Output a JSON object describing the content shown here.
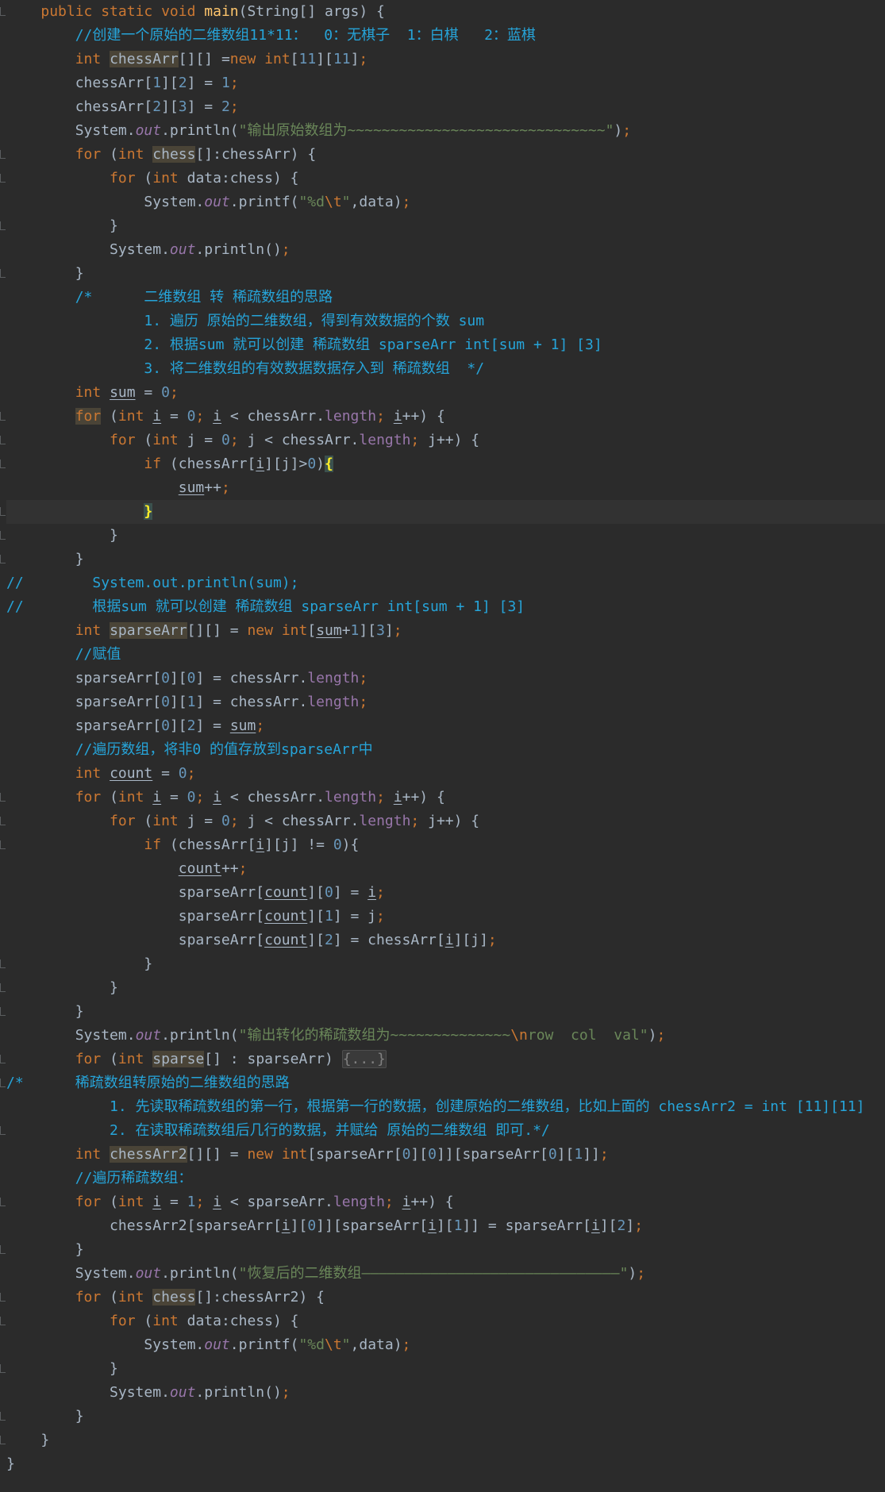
{
  "colors": {
    "background": "#2b2b2b",
    "keyword": "#cc7832",
    "number": "#6897bb",
    "string": "#6a8759",
    "comment": "#26a4d9",
    "field": "#9876aa",
    "method": "#ffc66d",
    "plain": "#a9b7c6"
  },
  "code_lines": [
    [
      [
        "    ",
        ""
      ],
      [
        "public static void ",
        "kw"
      ],
      [
        "main",
        "fn"
      ],
      [
        "(String[] args) {",
        ""
      ]
    ],
    [
      [
        "        ",
        ""
      ],
      [
        "//创建一个原始的二维数组11*11：  0：无棋子  1：白棋   2：蓝棋",
        "cmt"
      ]
    ],
    [
      [
        "        ",
        ""
      ],
      [
        "int ",
        "kw"
      ],
      [
        "chessArr",
        "hl"
      ],
      [
        "[][] =",
        ""
      ],
      [
        "new ",
        "kw"
      ],
      [
        "int",
        "kw"
      ],
      [
        "[",
        ""
      ],
      [
        "11",
        "num"
      ],
      [
        "][",
        ""
      ],
      [
        "11",
        "num"
      ],
      [
        "]",
        ""
      ],
      [
        ";",
        "kw"
      ]
    ],
    [
      [
        "        chessArr[",
        ""
      ],
      [
        "1",
        "num"
      ],
      [
        "][",
        ""
      ],
      [
        "2",
        "num"
      ],
      [
        "] = ",
        ""
      ],
      [
        "1",
        "num"
      ],
      [
        ";",
        "kw"
      ]
    ],
    [
      [
        "        chessArr[",
        ""
      ],
      [
        "2",
        "num"
      ],
      [
        "][",
        ""
      ],
      [
        "3",
        "num"
      ],
      [
        "] = ",
        ""
      ],
      [
        "2",
        "num"
      ],
      [
        ";",
        "kw"
      ]
    ],
    [
      [
        "        System.",
        ""
      ],
      [
        "out",
        "sfld"
      ],
      [
        ".println(",
        ""
      ],
      [
        "\"输出原始数组为~~~~~~~~~~~~~~~~~~~~~~~~~~~~~~\"",
        "str"
      ],
      [
        ")",
        ""
      ],
      [
        ";",
        "kw"
      ]
    ],
    [
      [
        "        ",
        ""
      ],
      [
        "for ",
        "kw"
      ],
      [
        "(",
        ""
      ],
      [
        "int ",
        "kw"
      ],
      [
        "chess",
        "hl"
      ],
      [
        "[]:chessArr) {",
        ""
      ]
    ],
    [
      [
        "            ",
        ""
      ],
      [
        "for ",
        "kw"
      ],
      [
        "(",
        ""
      ],
      [
        "int ",
        "kw"
      ],
      [
        "data:chess) {",
        ""
      ]
    ],
    [
      [
        "                System.",
        ""
      ],
      [
        "out",
        "sfld"
      ],
      [
        ".printf(",
        ""
      ],
      [
        "\"%d",
        "str"
      ],
      [
        "\\t",
        "esc"
      ],
      [
        "\"",
        "str"
      ],
      [
        ",",
        ""
      ],
      [
        "data)",
        ""
      ],
      [
        ";",
        "kw"
      ]
    ],
    [
      [
        "            }",
        ""
      ]
    ],
    [
      [
        "            System.",
        ""
      ],
      [
        "out",
        "sfld"
      ],
      [
        ".println()",
        ""
      ],
      [
        ";",
        "kw"
      ]
    ],
    [
      [
        "        }",
        ""
      ]
    ],
    [
      [
        "        ",
        ""
      ],
      [
        "/*      二维数组 转 稀疏数组的思路",
        "cmt"
      ]
    ],
    [
      [
        "                ",
        ""
      ],
      [
        "1. 遍历 原始的二维数组，得到有效数据的个数 sum",
        "cmt"
      ]
    ],
    [
      [
        "                ",
        ""
      ],
      [
        "2. 根据sum 就可以创建 稀疏数组 sparseArr int[sum + 1] [3]",
        "cmt"
      ]
    ],
    [
      [
        "                ",
        ""
      ],
      [
        "3. 将二维数组的有效数据数据存入到 稀疏数组  */",
        "cmt"
      ]
    ],
    [
      [
        "        ",
        ""
      ],
      [
        "int ",
        "kw"
      ],
      [
        "sum",
        "ul"
      ],
      [
        " = ",
        ""
      ],
      [
        "0",
        "num"
      ],
      [
        ";",
        "kw"
      ]
    ],
    [
      [
        "        ",
        ""
      ],
      [
        "for",
        "kw hl"
      ],
      [
        " (",
        ""
      ],
      [
        "int ",
        "kw"
      ],
      [
        "i",
        "ul"
      ],
      [
        " = ",
        ""
      ],
      [
        "0",
        "num"
      ],
      [
        "; ",
        "kw"
      ],
      [
        "i",
        "ul"
      ],
      [
        " < chessArr.",
        ""
      ],
      [
        "length",
        "fld"
      ],
      [
        "; ",
        "kw"
      ],
      [
        "i",
        "ul"
      ],
      [
        "++) {",
        ""
      ]
    ],
    [
      [
        "            ",
        ""
      ],
      [
        "for ",
        "kw"
      ],
      [
        "(",
        ""
      ],
      [
        "int ",
        "kw"
      ],
      [
        "j = ",
        ""
      ],
      [
        "0",
        "num"
      ],
      [
        "; ",
        "kw"
      ],
      [
        "j < chessArr.",
        ""
      ],
      [
        "length",
        "fld"
      ],
      [
        "; ",
        "kw"
      ],
      [
        "j++) {",
        ""
      ]
    ],
    [
      [
        "                ",
        ""
      ],
      [
        "if ",
        "kw"
      ],
      [
        "(chessArr[",
        ""
      ],
      [
        "i",
        "ul"
      ],
      [
        "][j]>",
        ""
      ],
      [
        "0",
        "num"
      ],
      [
        ")",
        ""
      ],
      [
        "{",
        "brace"
      ]
    ],
    [
      [
        "                    ",
        ""
      ],
      [
        "sum",
        "ul"
      ],
      [
        "++",
        ""
      ],
      [
        ";",
        "kw"
      ]
    ],
    [
      [
        "                ",
        ""
      ],
      [
        "}",
        "brace"
      ]
    ],
    [
      [
        "            }",
        ""
      ]
    ],
    [
      [
        "        }",
        ""
      ]
    ],
    [
      [
        "//        System.out.println(sum);",
        "cmt"
      ]
    ],
    [
      [
        "//        根据sum 就可以创建 稀疏数组 sparseArr int[sum + 1] [3]",
        "cmt"
      ]
    ],
    [
      [
        "        ",
        ""
      ],
      [
        "int ",
        "kw"
      ],
      [
        "sparseArr",
        "hl"
      ],
      [
        "[][] = ",
        ""
      ],
      [
        "new ",
        "kw"
      ],
      [
        "int",
        "kw"
      ],
      [
        "[",
        ""
      ],
      [
        "sum",
        "ul"
      ],
      [
        "+",
        ""
      ],
      [
        "1",
        "num"
      ],
      [
        "][",
        ""
      ],
      [
        "3",
        "num"
      ],
      [
        "]",
        ""
      ],
      [
        ";",
        "kw"
      ]
    ],
    [
      [
        "        ",
        ""
      ],
      [
        "//赋值",
        "cmt"
      ]
    ],
    [
      [
        "        sparseArr[",
        ""
      ],
      [
        "0",
        "num"
      ],
      [
        "][",
        ""
      ],
      [
        "0",
        "num"
      ],
      [
        "] = chessArr.",
        ""
      ],
      [
        "length",
        "fld"
      ],
      [
        ";",
        "kw"
      ]
    ],
    [
      [
        "        sparseArr[",
        ""
      ],
      [
        "0",
        "num"
      ],
      [
        "][",
        ""
      ],
      [
        "1",
        "num"
      ],
      [
        "] = chessArr.",
        ""
      ],
      [
        "length",
        "fld"
      ],
      [
        ";",
        "kw"
      ]
    ],
    [
      [
        "        sparseArr[",
        ""
      ],
      [
        "0",
        "num"
      ],
      [
        "][",
        ""
      ],
      [
        "2",
        "num"
      ],
      [
        "] = ",
        ""
      ],
      [
        "sum",
        "ul"
      ],
      [
        ";",
        "kw"
      ]
    ],
    [
      [
        "        ",
        ""
      ],
      [
        "//遍历数组，将非0 的值存放到sparseArr中",
        "cmt"
      ]
    ],
    [
      [
        "        ",
        ""
      ],
      [
        "int ",
        "kw"
      ],
      [
        "count",
        "ul"
      ],
      [
        " = ",
        ""
      ],
      [
        "0",
        "num"
      ],
      [
        ";",
        "kw"
      ]
    ],
    [
      [
        "        ",
        ""
      ],
      [
        "for ",
        "kw"
      ],
      [
        "(",
        ""
      ],
      [
        "int ",
        "kw"
      ],
      [
        "i",
        "ul"
      ],
      [
        " = ",
        ""
      ],
      [
        "0",
        "num"
      ],
      [
        "; ",
        "kw"
      ],
      [
        "i",
        "ul"
      ],
      [
        " < chessArr.",
        ""
      ],
      [
        "length",
        "fld"
      ],
      [
        "; ",
        "kw"
      ],
      [
        "i",
        "ul"
      ],
      [
        "++) {",
        ""
      ]
    ],
    [
      [
        "            ",
        ""
      ],
      [
        "for ",
        "kw"
      ],
      [
        "(",
        ""
      ],
      [
        "int ",
        "kw"
      ],
      [
        "j = ",
        ""
      ],
      [
        "0",
        "num"
      ],
      [
        "; ",
        "kw"
      ],
      [
        "j < chessArr.",
        ""
      ],
      [
        "length",
        "fld"
      ],
      [
        "; ",
        "kw"
      ],
      [
        "j++) {",
        ""
      ]
    ],
    [
      [
        "                ",
        ""
      ],
      [
        "if ",
        "kw"
      ],
      [
        "(chessArr[",
        ""
      ],
      [
        "i",
        "ul"
      ],
      [
        "][j] != ",
        ""
      ],
      [
        "0",
        "num"
      ],
      [
        "){",
        ""
      ]
    ],
    [
      [
        "                    ",
        ""
      ],
      [
        "count",
        "ul"
      ],
      [
        "++",
        ""
      ],
      [
        ";",
        "kw"
      ]
    ],
    [
      [
        "                    sparseArr[",
        ""
      ],
      [
        "count",
        "ul"
      ],
      [
        "][",
        ""
      ],
      [
        "0",
        "num"
      ],
      [
        "] = ",
        ""
      ],
      [
        "i",
        "ul"
      ],
      [
        ";",
        "kw"
      ]
    ],
    [
      [
        "                    sparseArr[",
        ""
      ],
      [
        "count",
        "ul"
      ],
      [
        "][",
        ""
      ],
      [
        "1",
        "num"
      ],
      [
        "] = j",
        ""
      ],
      [
        ";",
        "kw"
      ]
    ],
    [
      [
        "                    sparseArr[",
        ""
      ],
      [
        "count",
        "ul"
      ],
      [
        "][",
        ""
      ],
      [
        "2",
        "num"
      ],
      [
        "] = chessArr[",
        ""
      ],
      [
        "i",
        "ul"
      ],
      [
        "][j]",
        ""
      ],
      [
        ";",
        "kw"
      ]
    ],
    [
      [
        "                }",
        ""
      ]
    ],
    [
      [
        "            }",
        ""
      ]
    ],
    [
      [
        "        }",
        ""
      ]
    ],
    [
      [
        "        System.",
        ""
      ],
      [
        "out",
        "sfld"
      ],
      [
        ".println(",
        ""
      ],
      [
        "\"输出转化的稀疏数组为~~~~~~~~~~~~~~",
        "str"
      ],
      [
        "\\n",
        "esc"
      ],
      [
        "row  col  val\"",
        "str"
      ],
      [
        ")",
        ""
      ],
      [
        ";",
        "kw"
      ]
    ],
    [
      [
        "        ",
        ""
      ],
      [
        "for ",
        "kw"
      ],
      [
        "(",
        ""
      ],
      [
        "int ",
        "kw"
      ],
      [
        "sparse",
        "hl"
      ],
      [
        "[] : sparseArr) ",
        ""
      ],
      [
        "{...}",
        "folded"
      ]
    ],
    [
      [
        "/*",
        "cmt"
      ],
      [
        "      稀疏数组转原始的二维数组的思路",
        "cmt"
      ]
    ],
    [
      [
        "            ",
        ""
      ],
      [
        "1. 先读取稀疏数组的第一行，根据第一行的数据，创建原始的二维数组，比如上面的 chessArr2 = int [11][11]",
        "cmt"
      ]
    ],
    [
      [
        "            ",
        ""
      ],
      [
        "2. 在读取稀疏数组后几行的数据，并赋给 原始的二维数组 即可.*/",
        "cmt"
      ]
    ],
    [
      [
        "        ",
        ""
      ],
      [
        "int ",
        "kw"
      ],
      [
        "chessArr2",
        "hl"
      ],
      [
        "[][] = ",
        ""
      ],
      [
        "new ",
        "kw"
      ],
      [
        "int",
        "kw"
      ],
      [
        "[sparseArr[",
        ""
      ],
      [
        "0",
        "num"
      ],
      [
        "][",
        ""
      ],
      [
        "0",
        "num"
      ],
      [
        "]][sparseArr[",
        ""
      ],
      [
        "0",
        "num"
      ],
      [
        "][",
        ""
      ],
      [
        "1",
        "num"
      ],
      [
        "]]",
        ""
      ],
      [
        ";",
        "kw"
      ]
    ],
    [
      [
        "        ",
        ""
      ],
      [
        "//遍历稀疏数组：",
        "cmt"
      ]
    ],
    [
      [
        "        ",
        ""
      ],
      [
        "for ",
        "kw"
      ],
      [
        "(",
        ""
      ],
      [
        "int ",
        "kw"
      ],
      [
        "i",
        "ul"
      ],
      [
        " = ",
        ""
      ],
      [
        "1",
        "num"
      ],
      [
        "; ",
        "kw"
      ],
      [
        "i",
        "ul"
      ],
      [
        " < sparseArr.",
        ""
      ],
      [
        "length",
        "fld"
      ],
      [
        "; ",
        "kw"
      ],
      [
        "i",
        "ul"
      ],
      [
        "++) {",
        ""
      ]
    ],
    [
      [
        "            chessArr2[sparseArr[",
        ""
      ],
      [
        "i",
        "ul"
      ],
      [
        "][",
        ""
      ],
      [
        "0",
        "num"
      ],
      [
        "]][sparseArr[",
        ""
      ],
      [
        "i",
        "ul"
      ],
      [
        "][",
        ""
      ],
      [
        "1",
        "num"
      ],
      [
        "]] = sparseArr[",
        ""
      ],
      [
        "i",
        "ul"
      ],
      [
        "][",
        ""
      ],
      [
        "2",
        "num"
      ],
      [
        "]",
        ""
      ],
      [
        ";",
        "kw"
      ]
    ],
    [
      [
        "        }",
        ""
      ]
    ],
    [
      [
        "        System.",
        ""
      ],
      [
        "out",
        "sfld"
      ],
      [
        ".println(",
        ""
      ],
      [
        "\"恢复后的二维数组——————————————————————————————\"",
        "str"
      ],
      [
        ")",
        ""
      ],
      [
        ";",
        "kw"
      ]
    ],
    [
      [
        "        ",
        ""
      ],
      [
        "for ",
        "kw"
      ],
      [
        "(",
        ""
      ],
      [
        "int ",
        "kw"
      ],
      [
        "chess",
        "hl"
      ],
      [
        "[]:chessArr2) {",
        ""
      ]
    ],
    [
      [
        "            ",
        ""
      ],
      [
        "for ",
        "kw"
      ],
      [
        "(",
        ""
      ],
      [
        "int ",
        "kw"
      ],
      [
        "data:chess) {",
        ""
      ]
    ],
    [
      [
        "                System.",
        ""
      ],
      [
        "out",
        "sfld"
      ],
      [
        ".printf(",
        ""
      ],
      [
        "\"%d",
        "str"
      ],
      [
        "\\t",
        "esc"
      ],
      [
        "\"",
        "str"
      ],
      [
        ",",
        ""
      ],
      [
        "data)",
        ""
      ],
      [
        ";",
        "kw"
      ]
    ],
    [
      [
        "            }",
        ""
      ]
    ],
    [
      [
        "            System.",
        ""
      ],
      [
        "out",
        "sfld"
      ],
      [
        ".println()",
        ""
      ],
      [
        ";",
        "kw"
      ]
    ],
    [
      [
        "        }",
        ""
      ]
    ],
    [
      [
        "    }",
        ""
      ]
    ],
    [
      [
        "}",
        ""
      ]
    ]
  ]
}
